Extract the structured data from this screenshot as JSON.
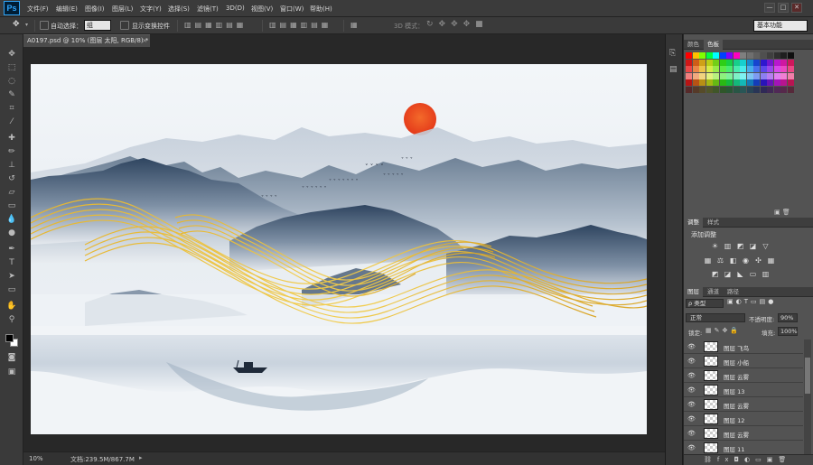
{
  "app": {
    "logo": "Ps"
  },
  "menu": [
    "文件(F)",
    "编辑(E)",
    "图像(I)",
    "图层(L)",
    "文字(Y)",
    "选择(S)",
    "滤镜(T)",
    "3D(D)",
    "视图(V)",
    "窗口(W)",
    "帮助(H)"
  ],
  "window_controls": [
    "—",
    "□",
    "✕"
  ],
  "options": {
    "auto_select_label": "自动选择：",
    "auto_select_value": "组",
    "show_transform_label": "显示变换控件",
    "mode_3d_label": "3D 模式：",
    "workspace": "基本功能"
  },
  "document": {
    "tab_title": "A0197.psd @ 10% (图层 太阳, RGB/8) *",
    "tab_close": "×"
  },
  "status": {
    "zoom": "10%",
    "doc_info": "文档:239.5M/867.7M"
  },
  "swatches_panel": {
    "tabs": [
      "颜色",
      "色板"
    ]
  },
  "adjustments_panel": {
    "tabs": [
      "调整",
      "样式"
    ],
    "add_label": "添加调整"
  },
  "layers_panel": {
    "tabs": [
      "图层",
      "通道",
      "路径"
    ],
    "filter_label": "ρ 类型",
    "blend_mode": "正常",
    "opacity_label": "不透明度:",
    "opacity_value": "90%",
    "lock_label": "锁定:",
    "fill_label": "填充:",
    "fill_value": "100%",
    "layers": [
      "图层 飞鸟",
      "图层 小船",
      "图层 云雾",
      "图层 13",
      "图层 云雾",
      "图层 12",
      "图层 云雾",
      "图层 11"
    ]
  },
  "colors": {
    "accent": "#31a8ff",
    "panel": "#535353",
    "sun": "#e8401c",
    "gold": "#d9a320"
  }
}
